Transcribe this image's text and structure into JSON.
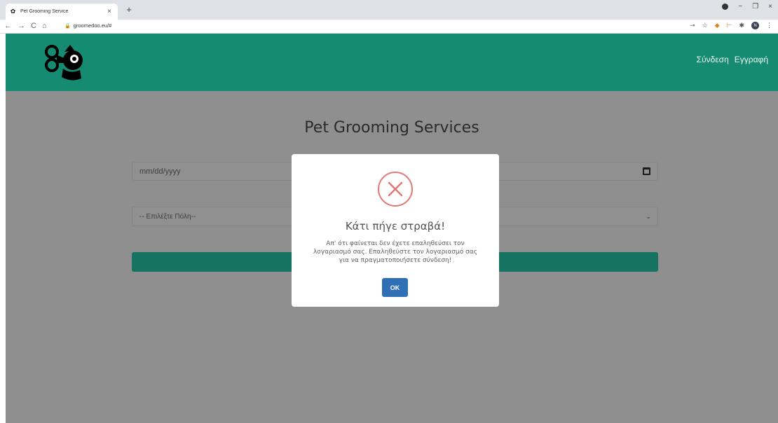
{
  "browser": {
    "tab_title": "Pet Grooming Service",
    "tab_close": "×",
    "new_tab": "+",
    "url": "groomedoo.eu/#",
    "nav": {
      "back": "←",
      "forward": "→",
      "reload": "C",
      "home": "⌂"
    },
    "window": {
      "minimize": "−",
      "restore": "❐",
      "close": "×"
    },
    "profile_initial": "N"
  },
  "header": {
    "nav_items": [
      {
        "label": "Σύνδεση"
      },
      {
        "label": "Εγγραφή"
      }
    ],
    "colors": {
      "background": "#158c71"
    }
  },
  "main": {
    "title": "Pet Grooming Services",
    "date_field": {
      "placeholder": "mm/dd/yyyy"
    },
    "city_select": {
      "selected": "-- Επιλέξτε Πόλη--"
    }
  },
  "modal": {
    "icon": "error-x-icon",
    "title": "Κάτι πήγε στραβά!",
    "message": "Απ' ότι φαίνεται δεν έχετε επαληθεύσει τον λογαριασμό σας. Επαληθεύστε τον λογαριασμό σας για να πραγματοποιήσετε σύνδεση!",
    "ok_label": "OK",
    "colors": {
      "icon": "#e07a72",
      "button": "#2f6fb6"
    }
  }
}
